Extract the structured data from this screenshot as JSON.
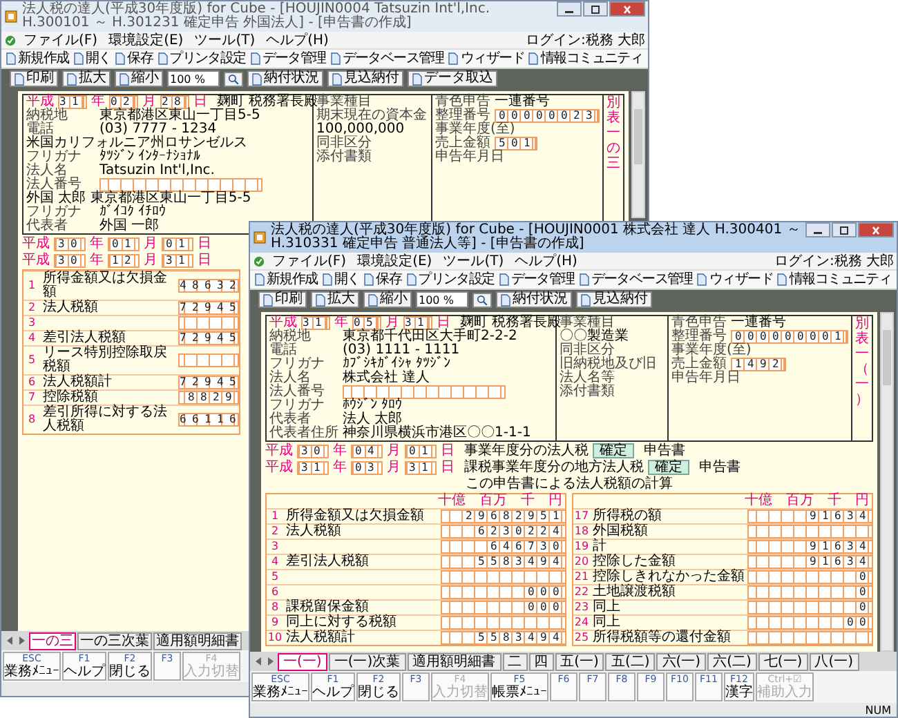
{
  "windows": [
    {
      "active": false,
      "title": "法人税の達人(平成30年度版) for Cube - [HOUJIN0004 Tatsuzin Int'l,Inc. H.300101 ～ H.301231 確定申告 外国法人] - [申告書の作成]",
      "menu": [
        "ファイル(F)",
        "環境設定(E)",
        "ツール(T)",
        "ヘルプ(H)"
      ],
      "login": "ログイン:税務 大郎",
      "toolbar": [
        "新規作成",
        "開く",
        "保存",
        "プリンタ設定",
        "データ管理",
        "データベース管理",
        "ウィザード",
        "情報コミュニティ"
      ],
      "toolbar2": [
        "印刷",
        "拡大",
        "縮小",
        "納付状況",
        "見込納付",
        "データ取込"
      ],
      "zoom": "100 %",
      "form": {
        "date": [
          "平成",
          "31",
          "年",
          "02",
          "月",
          "28",
          "日"
        ],
        "office": "麹町 税務署長殿",
        "left": [
          {
            "label": "納税地",
            "value": "東京都港区東山一丁目5-5"
          },
          {
            "label": "電話",
            "value": "(03) 7777 - 1234"
          },
          {
            "value": "米国カリフォルニア州ロサンゼルス"
          },
          {
            "label": "フリガナ",
            "value": "ﾀﾂｼﾞﾝ ｲﾝﾀｰﾅｼｮﾅﾙ"
          },
          {
            "label": "法人名",
            "value": "Tatsuzin Int'l,Inc."
          },
          {
            "label": "法人番号",
            "kind": "digits"
          },
          {
            "value": "外国 太郎 東京都港区東山一丁目5-5"
          },
          {
            "label": "フリガナ",
            "value": "ｶﾞｲｺｸ ｲﾁﾛｳ"
          },
          {
            "label": "代表者",
            "value": "外国 一郎"
          }
        ],
        "middle": [
          {
            "label": "事業種目"
          },
          {
            "label": "期末現在の資本金",
            "value": "100,000,000"
          },
          {
            "label": "同非区分"
          },
          {
            "label": "添付書類"
          }
        ],
        "right": [
          {
            "label": "青色申告",
            "value": "一連番号"
          },
          {
            "label": "整理番号",
            "value": "00000023",
            "kind": "digits"
          },
          {
            "label": "事業年度(至)"
          },
          {
            "label": "売上金額",
            "value": "501",
            "kind": "digits"
          },
          {
            "label": "申告年月日"
          }
        ],
        "side_note": "別表一の三",
        "periods": [
          {
            "date": [
              "平成",
              "30",
              "年",
              "01",
              "月",
              "01",
              "日"
            ]
          },
          {
            "date": [
              "平成",
              "30",
              "年",
              "12",
              "月",
              "31",
              "日"
            ]
          }
        ],
        "calc_columns": [
          {
            "rows": [
              {
                "no": "1",
                "label": "所得金額又は欠損金額",
                "value": "48632"
              },
              {
                "no": "2",
                "label": "法人税額",
                "value": "72945"
              },
              {
                "no": "3"
              },
              {
                "no": "4",
                "label": "差引法人税額",
                "value": "72945"
              },
              {
                "no": "5",
                "label": "リース特別控除取戻税額"
              },
              {
                "no": "6",
                "label": "法人税額計",
                "value": "72945"
              },
              {
                "no": "7",
                "label": "控除税額",
                "value": "8829"
              },
              {
                "no": "8",
                "label": "差引所得に対する法人税額",
                "value": "66116"
              }
            ]
          }
        ]
      },
      "tabs": [
        {
          "label": "一の三",
          "selected": true
        },
        {
          "label": "一の三次葉",
          "selected": false
        },
        {
          "label": "適用額明細書",
          "selected": false
        }
      ],
      "fkeys": [
        {
          "key": "ESC",
          "label": "業務ﾒﾆｭｰ",
          "disabled": false
        },
        {
          "key": "F1",
          "label": "ヘルプ",
          "disabled": false
        },
        {
          "key": "F2",
          "label": "閉じる",
          "disabled": false
        },
        {
          "key": "F3",
          "disabled": false
        },
        {
          "key": "F4",
          "label": "入力切替",
          "disabled": true
        }
      ]
    },
    {
      "active": true,
      "title": "法人税の達人(平成30年度版) for Cube - [HOUJIN0001 株式会社 達人 H.300401 ～ H.310331 確定申告 普通法人等] - [申告書の作成]",
      "menu": [
        "ファイル(F)",
        "環境設定(E)",
        "ツール(T)",
        "ヘルプ(H)"
      ],
      "login": "ログイン:税務 大郎",
      "toolbar": [
        "新規作成",
        "開く",
        "保存",
        "プリンタ設定",
        "データ管理",
        "データベース管理",
        "ウィザード",
        "情報コミュニティ"
      ],
      "toolbar2": [
        "印刷",
        "拡大",
        "縮小",
        "納付状況",
        "見込納付"
      ],
      "zoom": "100 %",
      "form": {
        "date": [
          "平成",
          "31",
          "年",
          "05",
          "月",
          "31",
          "日"
        ],
        "office": "麹町 税務署長殿",
        "left": [
          {
            "label": "納税地",
            "value": "東京都千代田区大手町2-2-2"
          },
          {
            "label": "電話",
            "value": "(03) 1111 - 1111"
          },
          {
            "label": "フリガナ",
            "value": "ｶﾌﾞｼｷｶﾞｲｼｬ ﾀﾂｼﾞﾝ"
          },
          {
            "label": "法人名",
            "value": "株式会社 達人"
          },
          {
            "label": "法人番号",
            "kind": "digits"
          },
          {
            "label": "フリガナ",
            "value": "ﾎｳｼﾞﾝ ﾀﾛｳ"
          },
          {
            "label": "代表者",
            "value": "法人 太郎"
          },
          {
            "label": "代表者住所",
            "value": "神奈川県横浜市港区〇〇1-1-1"
          }
        ],
        "middle": [
          {
            "label": "事業種目",
            "value": "〇〇製造業"
          },
          {
            "label": "同非区分"
          },
          {
            "label": "旧納税地及び旧法人名等"
          },
          {
            "label": "添付書類"
          }
        ],
        "right": [
          {
            "label": "青色申告",
            "value": "一連番号"
          },
          {
            "label": "整理番号",
            "value": "000000001",
            "kind": "digits"
          },
          {
            "label": "事業年度(至)"
          },
          {
            "label": "売上金額",
            "value": "1492",
            "kind": "digits"
          },
          {
            "label": "申告年月日"
          }
        ],
        "side_note": "別表一（一）",
        "periods": [
          {
            "date": [
              "平成",
              "30",
              "年",
              "04",
              "月",
              "01",
              "日"
            ],
            "text": "事業年度分の法人税",
            "status": "確定",
            "suffix": "申告書"
          },
          {
            "date": [
              "平成",
              "31",
              "年",
              "03",
              "月",
              "31",
              "日"
            ],
            "text": "課税事業年度分の地方法人税",
            "status": "確定",
            "suffix": "申告書"
          }
        ],
        "calc_title": "この申告書による法人税額の計算",
        "calc_columns": [
          {
            "units": [
              "十億",
              "百万",
              "千",
              "円"
            ],
            "rows": [
              {
                "no": "1",
                "label": "所得金額又は欠損金額",
                "value": "29682951"
              },
              {
                "no": "2",
                "label": "法人税額",
                "value": "6230224"
              },
              {
                "no": "3",
                "value": "646730"
              },
              {
                "no": "4",
                "label": "差引法人税額",
                "value": "5583494"
              },
              {
                "no": "5"
              },
              {
                "no": "6",
                "value": "000"
              },
              {
                "no": "8",
                "label": "課税留保金額",
                "value": "000"
              },
              {
                "no": "9",
                "label": "同上に対する税額"
              },
              {
                "no": "10",
                "label": "法人税額計",
                "value": "5583494"
              }
            ]
          },
          {
            "units": [
              "十億",
              "百万",
              "千",
              "円"
            ],
            "rows": [
              {
                "no": "17",
                "label": "所得税の額",
                "value": "91634"
              },
              {
                "no": "18",
                "label": "外国税額"
              },
              {
                "no": "19",
                "label": "計",
                "value": "91634"
              },
              {
                "no": "20",
                "label": "控除した金額",
                "value": "91634"
              },
              {
                "no": "21",
                "label": "控除しきれなかった金額",
                "value": "0"
              },
              {
                "no": "22",
                "label": "土地譲渡税額",
                "value": "0"
              },
              {
                "no": "23",
                "label": "同上",
                "value": "0"
              },
              {
                "no": "24",
                "label": "同上",
                "value": "00"
              },
              {
                "no": "25",
                "label": "所得税額等の還付金額"
              }
            ]
          }
        ]
      },
      "tabs": [
        {
          "label": "一(一)",
          "selected": true
        },
        {
          "label": "一(一)次葉",
          "selected": false
        },
        {
          "label": "適用額明細書",
          "selected": false
        },
        {
          "label": "二",
          "selected": false
        },
        {
          "label": "四",
          "selected": false
        },
        {
          "label": "五(一)",
          "selected": false
        },
        {
          "label": "五(二)",
          "selected": false
        },
        {
          "label": "六(一)",
          "selected": false
        },
        {
          "label": "六(二)",
          "selected": false
        },
        {
          "label": "七(一)",
          "selected": false
        },
        {
          "label": "八(一)",
          "selected": false
        }
      ],
      "fkeys": [
        {
          "key": "ESC",
          "label": "業務ﾒﾆｭｰ",
          "disabled": false
        },
        {
          "key": "F1",
          "label": "ヘルプ",
          "disabled": false
        },
        {
          "key": "F2",
          "label": "閉じる",
          "disabled": false
        },
        {
          "key": "F3",
          "disabled": false
        },
        {
          "key": "F4",
          "label": "入力切替",
          "disabled": true
        },
        {
          "key": "F5",
          "label": "帳票ﾒﾆｭｰ",
          "disabled": false
        },
        {
          "key": "F6",
          "disabled": false
        },
        {
          "key": "F7",
          "disabled": false
        },
        {
          "key": "F8",
          "disabled": false
        },
        {
          "key": "F9",
          "disabled": false
        },
        {
          "key": "F10",
          "disabled": false
        },
        {
          "key": "F11",
          "disabled": false
        },
        {
          "key": "F12",
          "label": "漢字",
          "disabled": false
        },
        {
          "key": "Ctrl+☑",
          "label": "補助入力",
          "disabled": true
        }
      ],
      "status": "NUM"
    }
  ]
}
